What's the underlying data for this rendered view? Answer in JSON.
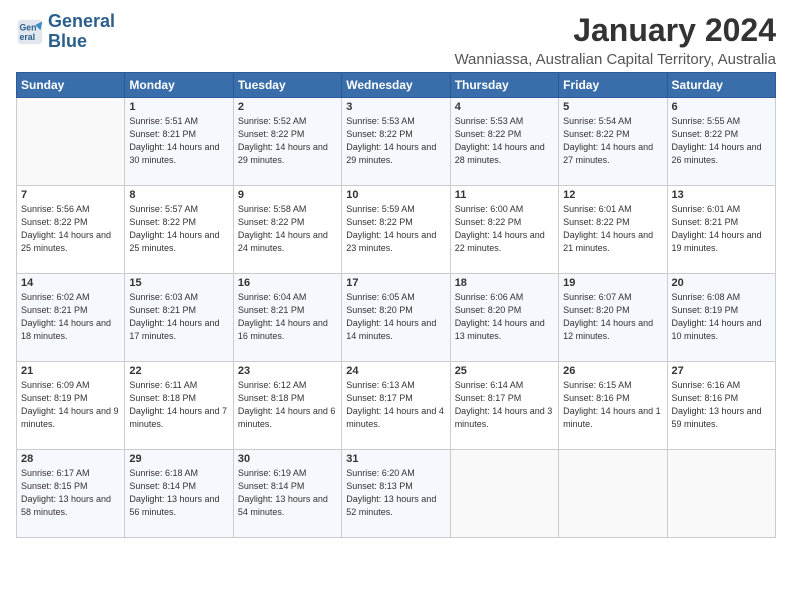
{
  "logo": {
    "line1": "General",
    "line2": "Blue"
  },
  "title": "January 2024",
  "subtitle": "Wanniassa, Australian Capital Territory, Australia",
  "days_of_week": [
    "Sunday",
    "Monday",
    "Tuesday",
    "Wednesday",
    "Thursday",
    "Friday",
    "Saturday"
  ],
  "weeks": [
    [
      {
        "day": "",
        "sunrise": "",
        "sunset": "",
        "daylight": ""
      },
      {
        "day": "1",
        "sunrise": "Sunrise: 5:51 AM",
        "sunset": "Sunset: 8:21 PM",
        "daylight": "Daylight: 14 hours and 30 minutes."
      },
      {
        "day": "2",
        "sunrise": "Sunrise: 5:52 AM",
        "sunset": "Sunset: 8:22 PM",
        "daylight": "Daylight: 14 hours and 29 minutes."
      },
      {
        "day": "3",
        "sunrise": "Sunrise: 5:53 AM",
        "sunset": "Sunset: 8:22 PM",
        "daylight": "Daylight: 14 hours and 29 minutes."
      },
      {
        "day": "4",
        "sunrise": "Sunrise: 5:53 AM",
        "sunset": "Sunset: 8:22 PM",
        "daylight": "Daylight: 14 hours and 28 minutes."
      },
      {
        "day": "5",
        "sunrise": "Sunrise: 5:54 AM",
        "sunset": "Sunset: 8:22 PM",
        "daylight": "Daylight: 14 hours and 27 minutes."
      },
      {
        "day": "6",
        "sunrise": "Sunrise: 5:55 AM",
        "sunset": "Sunset: 8:22 PM",
        "daylight": "Daylight: 14 hours and 26 minutes."
      }
    ],
    [
      {
        "day": "7",
        "sunrise": "Sunrise: 5:56 AM",
        "sunset": "Sunset: 8:22 PM",
        "daylight": "Daylight: 14 hours and 25 minutes."
      },
      {
        "day": "8",
        "sunrise": "Sunrise: 5:57 AM",
        "sunset": "Sunset: 8:22 PM",
        "daylight": "Daylight: 14 hours and 25 minutes."
      },
      {
        "day": "9",
        "sunrise": "Sunrise: 5:58 AM",
        "sunset": "Sunset: 8:22 PM",
        "daylight": "Daylight: 14 hours and 24 minutes."
      },
      {
        "day": "10",
        "sunrise": "Sunrise: 5:59 AM",
        "sunset": "Sunset: 8:22 PM",
        "daylight": "Daylight: 14 hours and 23 minutes."
      },
      {
        "day": "11",
        "sunrise": "Sunrise: 6:00 AM",
        "sunset": "Sunset: 8:22 PM",
        "daylight": "Daylight: 14 hours and 22 minutes."
      },
      {
        "day": "12",
        "sunrise": "Sunrise: 6:01 AM",
        "sunset": "Sunset: 8:22 PM",
        "daylight": "Daylight: 14 hours and 21 minutes."
      },
      {
        "day": "13",
        "sunrise": "Sunrise: 6:01 AM",
        "sunset": "Sunset: 8:21 PM",
        "daylight": "Daylight: 14 hours and 19 minutes."
      }
    ],
    [
      {
        "day": "14",
        "sunrise": "Sunrise: 6:02 AM",
        "sunset": "Sunset: 8:21 PM",
        "daylight": "Daylight: 14 hours and 18 minutes."
      },
      {
        "day": "15",
        "sunrise": "Sunrise: 6:03 AM",
        "sunset": "Sunset: 8:21 PM",
        "daylight": "Daylight: 14 hours and 17 minutes."
      },
      {
        "day": "16",
        "sunrise": "Sunrise: 6:04 AM",
        "sunset": "Sunset: 8:21 PM",
        "daylight": "Daylight: 14 hours and 16 minutes."
      },
      {
        "day": "17",
        "sunrise": "Sunrise: 6:05 AM",
        "sunset": "Sunset: 8:20 PM",
        "daylight": "Daylight: 14 hours and 14 minutes."
      },
      {
        "day": "18",
        "sunrise": "Sunrise: 6:06 AM",
        "sunset": "Sunset: 8:20 PM",
        "daylight": "Daylight: 14 hours and 13 minutes."
      },
      {
        "day": "19",
        "sunrise": "Sunrise: 6:07 AM",
        "sunset": "Sunset: 8:20 PM",
        "daylight": "Daylight: 14 hours and 12 minutes."
      },
      {
        "day": "20",
        "sunrise": "Sunrise: 6:08 AM",
        "sunset": "Sunset: 8:19 PM",
        "daylight": "Daylight: 14 hours and 10 minutes."
      }
    ],
    [
      {
        "day": "21",
        "sunrise": "Sunrise: 6:09 AM",
        "sunset": "Sunset: 8:19 PM",
        "daylight": "Daylight: 14 hours and 9 minutes."
      },
      {
        "day": "22",
        "sunrise": "Sunrise: 6:11 AM",
        "sunset": "Sunset: 8:18 PM",
        "daylight": "Daylight: 14 hours and 7 minutes."
      },
      {
        "day": "23",
        "sunrise": "Sunrise: 6:12 AM",
        "sunset": "Sunset: 8:18 PM",
        "daylight": "Daylight: 14 hours and 6 minutes."
      },
      {
        "day": "24",
        "sunrise": "Sunrise: 6:13 AM",
        "sunset": "Sunset: 8:17 PM",
        "daylight": "Daylight: 14 hours and 4 minutes."
      },
      {
        "day": "25",
        "sunrise": "Sunrise: 6:14 AM",
        "sunset": "Sunset: 8:17 PM",
        "daylight": "Daylight: 14 hours and 3 minutes."
      },
      {
        "day": "26",
        "sunrise": "Sunrise: 6:15 AM",
        "sunset": "Sunset: 8:16 PM",
        "daylight": "Daylight: 14 hours and 1 minute."
      },
      {
        "day": "27",
        "sunrise": "Sunrise: 6:16 AM",
        "sunset": "Sunset: 8:16 PM",
        "daylight": "Daylight: 13 hours and 59 minutes."
      }
    ],
    [
      {
        "day": "28",
        "sunrise": "Sunrise: 6:17 AM",
        "sunset": "Sunset: 8:15 PM",
        "daylight": "Daylight: 13 hours and 58 minutes."
      },
      {
        "day": "29",
        "sunrise": "Sunrise: 6:18 AM",
        "sunset": "Sunset: 8:14 PM",
        "daylight": "Daylight: 13 hours and 56 minutes."
      },
      {
        "day": "30",
        "sunrise": "Sunrise: 6:19 AM",
        "sunset": "Sunset: 8:14 PM",
        "daylight": "Daylight: 13 hours and 54 minutes."
      },
      {
        "day": "31",
        "sunrise": "Sunrise: 6:20 AM",
        "sunset": "Sunset: 8:13 PM",
        "daylight": "Daylight: 13 hours and 52 minutes."
      },
      {
        "day": "",
        "sunrise": "",
        "sunset": "",
        "daylight": ""
      },
      {
        "day": "",
        "sunrise": "",
        "sunset": "",
        "daylight": ""
      },
      {
        "day": "",
        "sunrise": "",
        "sunset": "",
        "daylight": ""
      }
    ]
  ]
}
